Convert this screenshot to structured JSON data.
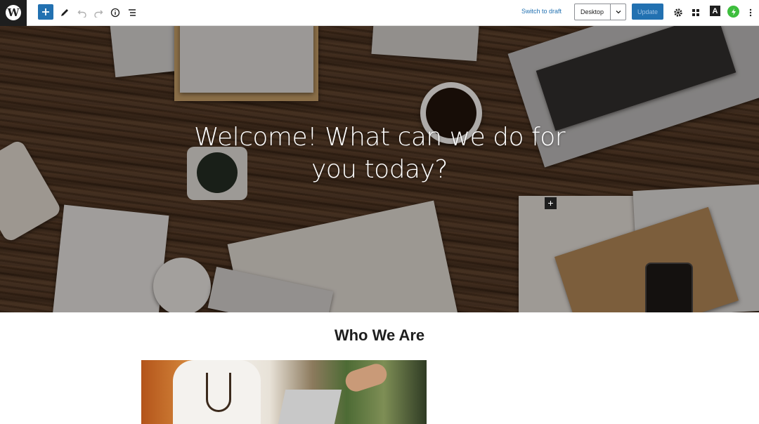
{
  "toolbar": {
    "logo_letter": "W",
    "switch_to_draft": "Switch to draft",
    "device_preview": "Desktop",
    "update": "Update",
    "astra_letter": "A",
    "icons": [
      "wordpress-logo",
      "plus-icon",
      "pencil-icon",
      "undo-icon",
      "redo-icon",
      "info-icon",
      "list-view-icon",
      "chevron-down-icon",
      "gear-icon",
      "blocks-icon",
      "astra-icon",
      "performance-icon",
      "kebab-menu-icon"
    ]
  },
  "hero": {
    "title": "Welcome! What can we do for you today?",
    "add_block_symbol": "+"
  },
  "content": {
    "section_heading": "Who We Are"
  },
  "colors": {
    "accent": "#2271b1",
    "toolbar_dark": "#1e1e1e",
    "green": "#3dbe3d"
  }
}
